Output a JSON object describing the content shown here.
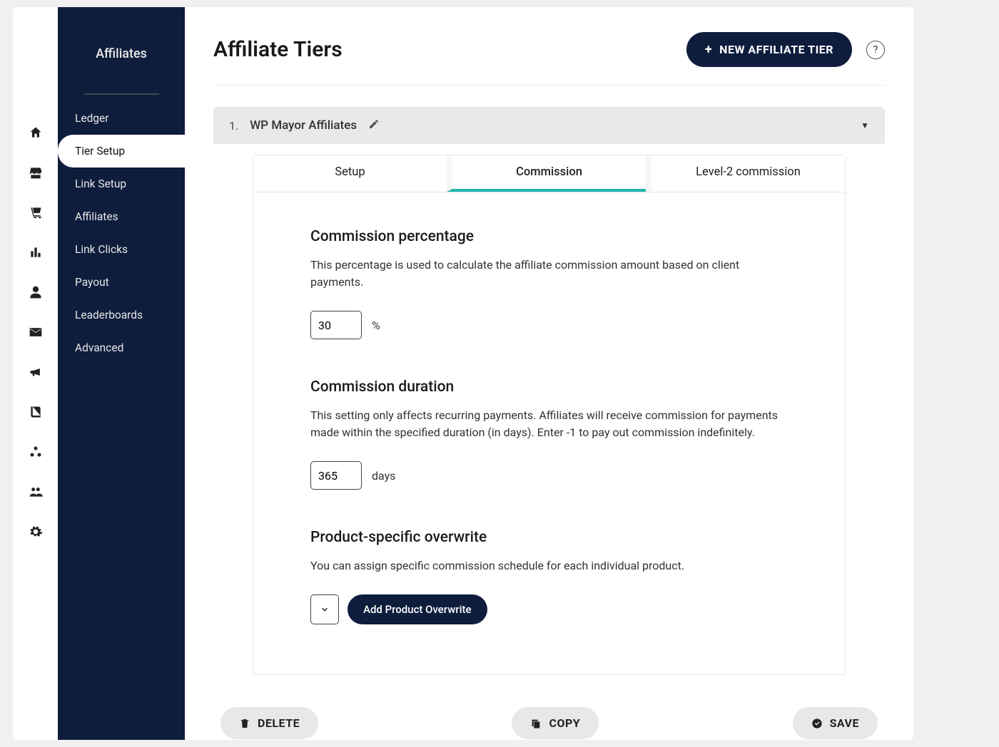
{
  "sidebar": {
    "title": "Affiliates",
    "items": [
      {
        "label": "Ledger"
      },
      {
        "label": "Tier Setup"
      },
      {
        "label": "Link Setup"
      },
      {
        "label": "Affiliates"
      },
      {
        "label": "Link Clicks"
      },
      {
        "label": "Payout"
      },
      {
        "label": "Leaderboards"
      },
      {
        "label": "Advanced"
      }
    ]
  },
  "header": {
    "title": "Affiliate Tiers",
    "new_button": "NEW AFFILIATE TIER",
    "help": "?"
  },
  "tier": {
    "index": "1.",
    "name": "WP Mayor Affiliates"
  },
  "tabs": [
    {
      "label": "Setup"
    },
    {
      "label": "Commission"
    },
    {
      "label": "Level-2 commission"
    }
  ],
  "commission": {
    "percentage": {
      "title": "Commission percentage",
      "desc": "This percentage is used to calculate the affiliate commission amount based on client payments.",
      "value": "30",
      "unit": "%"
    },
    "duration": {
      "title": "Commission duration",
      "desc": "This setting only affects recurring payments. Affiliates will receive commission for payments made within the specified duration (in days). Enter -1 to pay out commission indefinitely.",
      "value": "365",
      "unit": "days"
    },
    "overwrite": {
      "title": "Product-specific overwrite",
      "desc": "You can assign specific commission schedule for each individual product.",
      "button": "Add Product Overwrite"
    }
  },
  "actions": {
    "delete": "DELETE",
    "copy": "COPY",
    "save": "SAVE"
  },
  "rail_icons": [
    "home",
    "store",
    "cart",
    "stats",
    "user",
    "mail",
    "megaphone",
    "book",
    "nodes",
    "group",
    "gear"
  ]
}
